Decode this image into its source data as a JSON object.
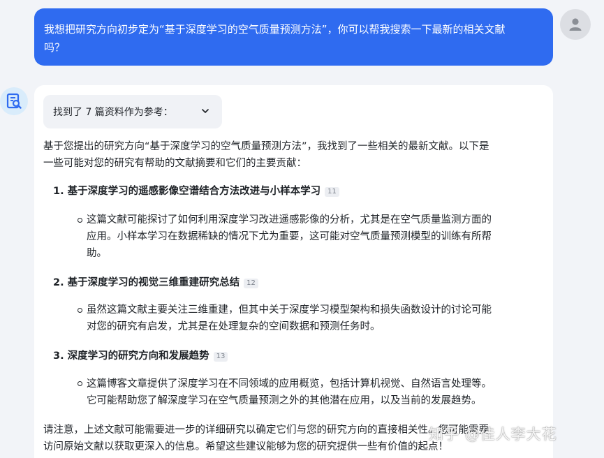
{
  "user_message": {
    "line1": "我想把研究方向初步定为“基于深度学习的空气质量预测方法”，你可以帮我搜索一下最新的相关文献",
    "line2": "吗？"
  },
  "icons": {
    "user_avatar": "user-avatar-icon",
    "bot_avatar": "document-search-icon",
    "refs_toggle": "chevron-down-icon"
  },
  "answer": {
    "refs_label": "找到了 7 篇资料作为参考：",
    "intro_line1": "基于您提出的研究方向“基于深度学习的空气质量预测方法”，我找到了一些相关的最新文献。以下是",
    "intro_line2": "一些可能对您的研究有帮助的文献摘要和它们的主要贡献：",
    "items": [
      {
        "title": "1. 基于深度学习的遥感影像空谱结合方法改进与小样本学习",
        "cite": "11",
        "lines": [
          "这篇文献可能探讨了如何利用深度学习改进遥感影像的分析，尤其是在空气质量监测方面的",
          "应用。小样本学习在数据稀缺的情况下尤为重要，这可能对空气质量预测模型的训练有所帮",
          "助。"
        ]
      },
      {
        "title": "2. 基于深度学习的视觉三维重建研究总结",
        "cite": "12",
        "lines": [
          "虽然这篇文献主要关注三维重建，但其中关于深度学习模型架构和损失函数设计的讨论可能",
          "对您的研究有启发，尤其是在处理复杂的空间数据和预测任务时。"
        ]
      },
      {
        "title": "3. 深度学习的研究方向和发展趋势",
        "cite": "13",
        "lines": [
          "这篇博客文章提供了深度学习在不同领域的应用概览，包括计算机视觉、自然语言处理等。",
          "它可能帮助您了解深度学习在空气质量预测之外的其他潜在应用，以及当前的发展趋势。"
        ]
      }
    ],
    "closing_line1": "请注意，上述文献可能需要进一步的详细研究以确定它们与您的研究方向的直接相关性。您可能需要",
    "closing_line2": "访问原始文献以获取更深入的信息。希望这些建议能够为您的研究提供一些有价值的起点！"
  },
  "watermark": "知乎 @佳人李大花",
  "colors": {
    "user_bubble": "#2f6bf0",
    "page_bg": "#f2f4f8",
    "card_bg": "#ffffff"
  }
}
